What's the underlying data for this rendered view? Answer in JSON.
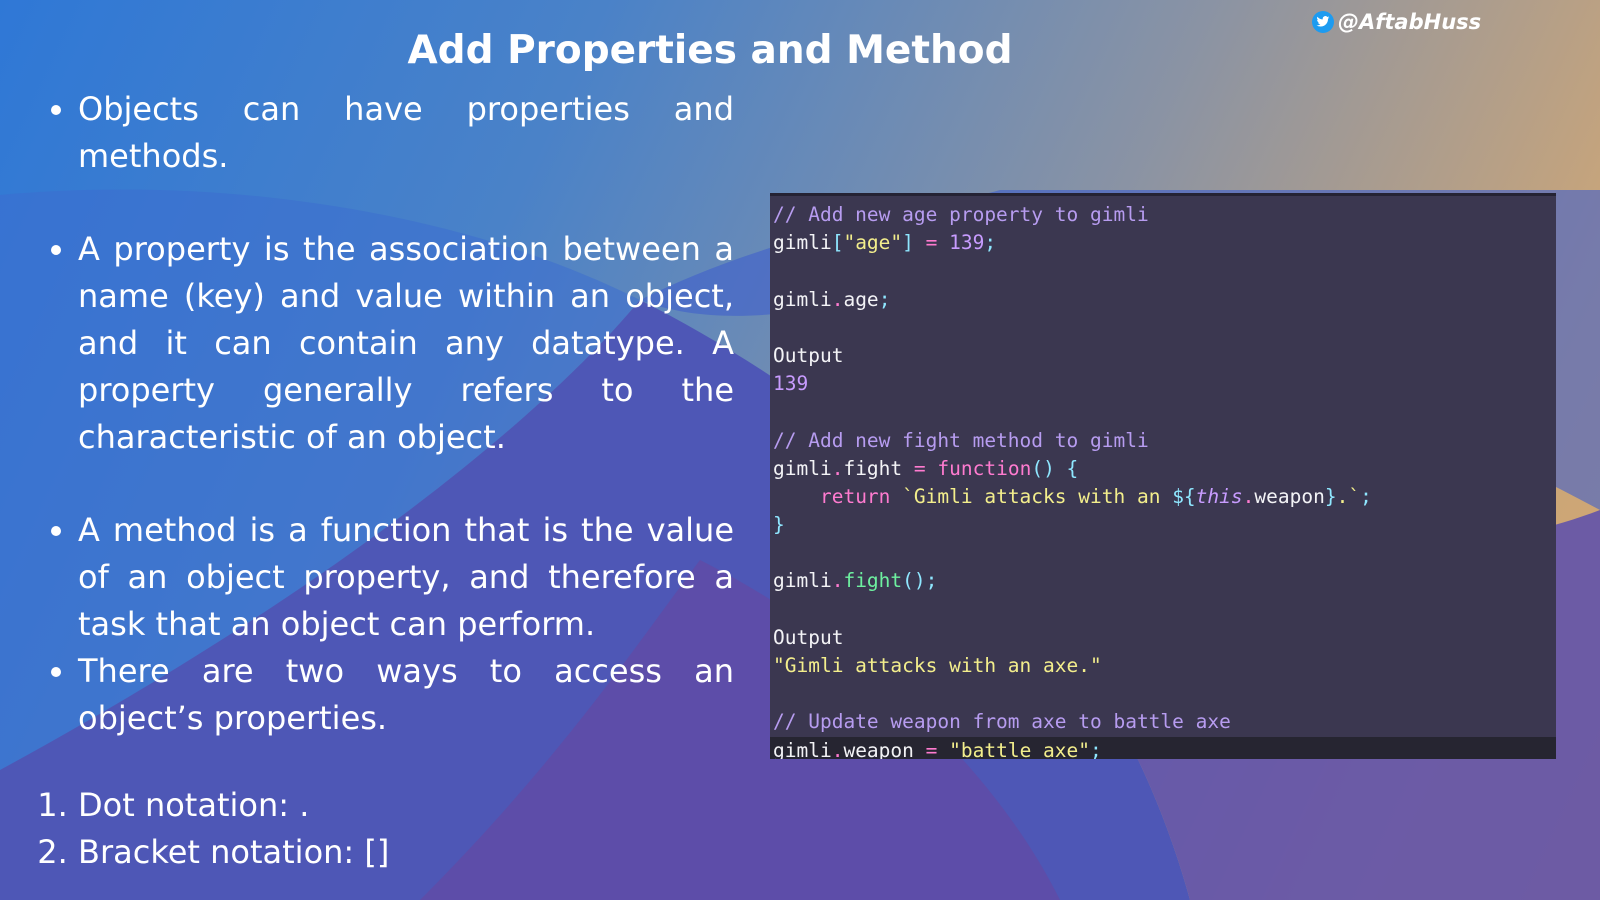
{
  "slide": {
    "title": "Add Properties and Method",
    "handle": "@AftabHuss",
    "handle_icon": "twitter-bird-icon",
    "bullets": [
      "Objects can have properties and methods.",
      "A property is the association between a name (key) and value within an object, and it can contain any datatype. A property generally refers to the characteristic of an object.",
      "A method is a function that is the value of an object property, and therefore a task that an object can perform.",
      "There are two ways to access an object’s properties."
    ],
    "numbered": [
      "Dot notation: .",
      "Bracket notation: []"
    ]
  },
  "code": {
    "lines": [
      [
        {
          "t": "// Add new age property to gimli",
          "c": "comment"
        }
      ],
      [
        {
          "t": "gimli",
          "c": "plain"
        },
        {
          "t": "[",
          "c": "punc"
        },
        {
          "t": "\"age\"",
          "c": "str"
        },
        {
          "t": "] ",
          "c": "punc"
        },
        {
          "t": "=",
          "c": "op"
        },
        {
          "t": " ",
          "c": "plain"
        },
        {
          "t": "139",
          "c": "num"
        },
        {
          "t": ";",
          "c": "punc"
        }
      ],
      [],
      [
        {
          "t": "gimli",
          "c": "plain"
        },
        {
          "t": ".",
          "c": "op"
        },
        {
          "t": "age",
          "c": "plain"
        },
        {
          "t": ";",
          "c": "punc"
        }
      ],
      [],
      [
        {
          "t": "Output",
          "c": "plain"
        }
      ],
      [
        {
          "t": "139",
          "c": "num"
        }
      ],
      [],
      [
        {
          "t": "// Add new fight method to gimli",
          "c": "comment"
        }
      ],
      [
        {
          "t": "gimli",
          "c": "plain"
        },
        {
          "t": ".",
          "c": "op"
        },
        {
          "t": "fight ",
          "c": "plain"
        },
        {
          "t": "=",
          "c": "op"
        },
        {
          "t": " ",
          "c": "plain"
        },
        {
          "t": "function",
          "c": "kw"
        },
        {
          "t": "() {",
          "c": "punc"
        }
      ],
      [
        {
          "t": "    ",
          "c": "plain"
        },
        {
          "t": "return",
          "c": "kw"
        },
        {
          "t": " `Gimli attacks with an ",
          "c": "str"
        },
        {
          "t": "${",
          "c": "punc"
        },
        {
          "t": "this",
          "c": "this"
        },
        {
          "t": ".",
          "c": "op"
        },
        {
          "t": "weapon",
          "c": "plain"
        },
        {
          "t": "}",
          "c": "punc"
        },
        {
          "t": ".`",
          "c": "str"
        },
        {
          "t": ";",
          "c": "punc"
        }
      ],
      [
        {
          "t": "}",
          "c": "punc"
        }
      ],
      [],
      [
        {
          "t": "gimli",
          "c": "plain"
        },
        {
          "t": ".",
          "c": "op"
        },
        {
          "t": "fight",
          "c": "fn"
        },
        {
          "t": "();",
          "c": "punc"
        }
      ],
      [],
      [
        {
          "t": "Output",
          "c": "plain"
        }
      ],
      [
        {
          "t": "\"Gimli attacks with an axe.\"",
          "c": "str"
        }
      ],
      [],
      [
        {
          "t": "// Update weapon from axe to battle axe",
          "c": "comment"
        }
      ],
      [
        {
          "t": "gimli",
          "c": "plain"
        },
        {
          "t": ".",
          "c": "op"
        },
        {
          "t": "weapon ",
          "c": "plain"
        },
        {
          "t": "=",
          "c": "op"
        },
        {
          "t": " ",
          "c": "plain"
        },
        {
          "t": "\"battle axe\"",
          "c": "str"
        },
        {
          "t": ";",
          "c": "punc"
        }
      ]
    ]
  },
  "colors": {
    "code_background": "#3b3750",
    "comment": "#b79cf0",
    "string": "#f3ee8c",
    "keyword": "#ff7bd0",
    "function_call": "#6ef0a0"
  }
}
